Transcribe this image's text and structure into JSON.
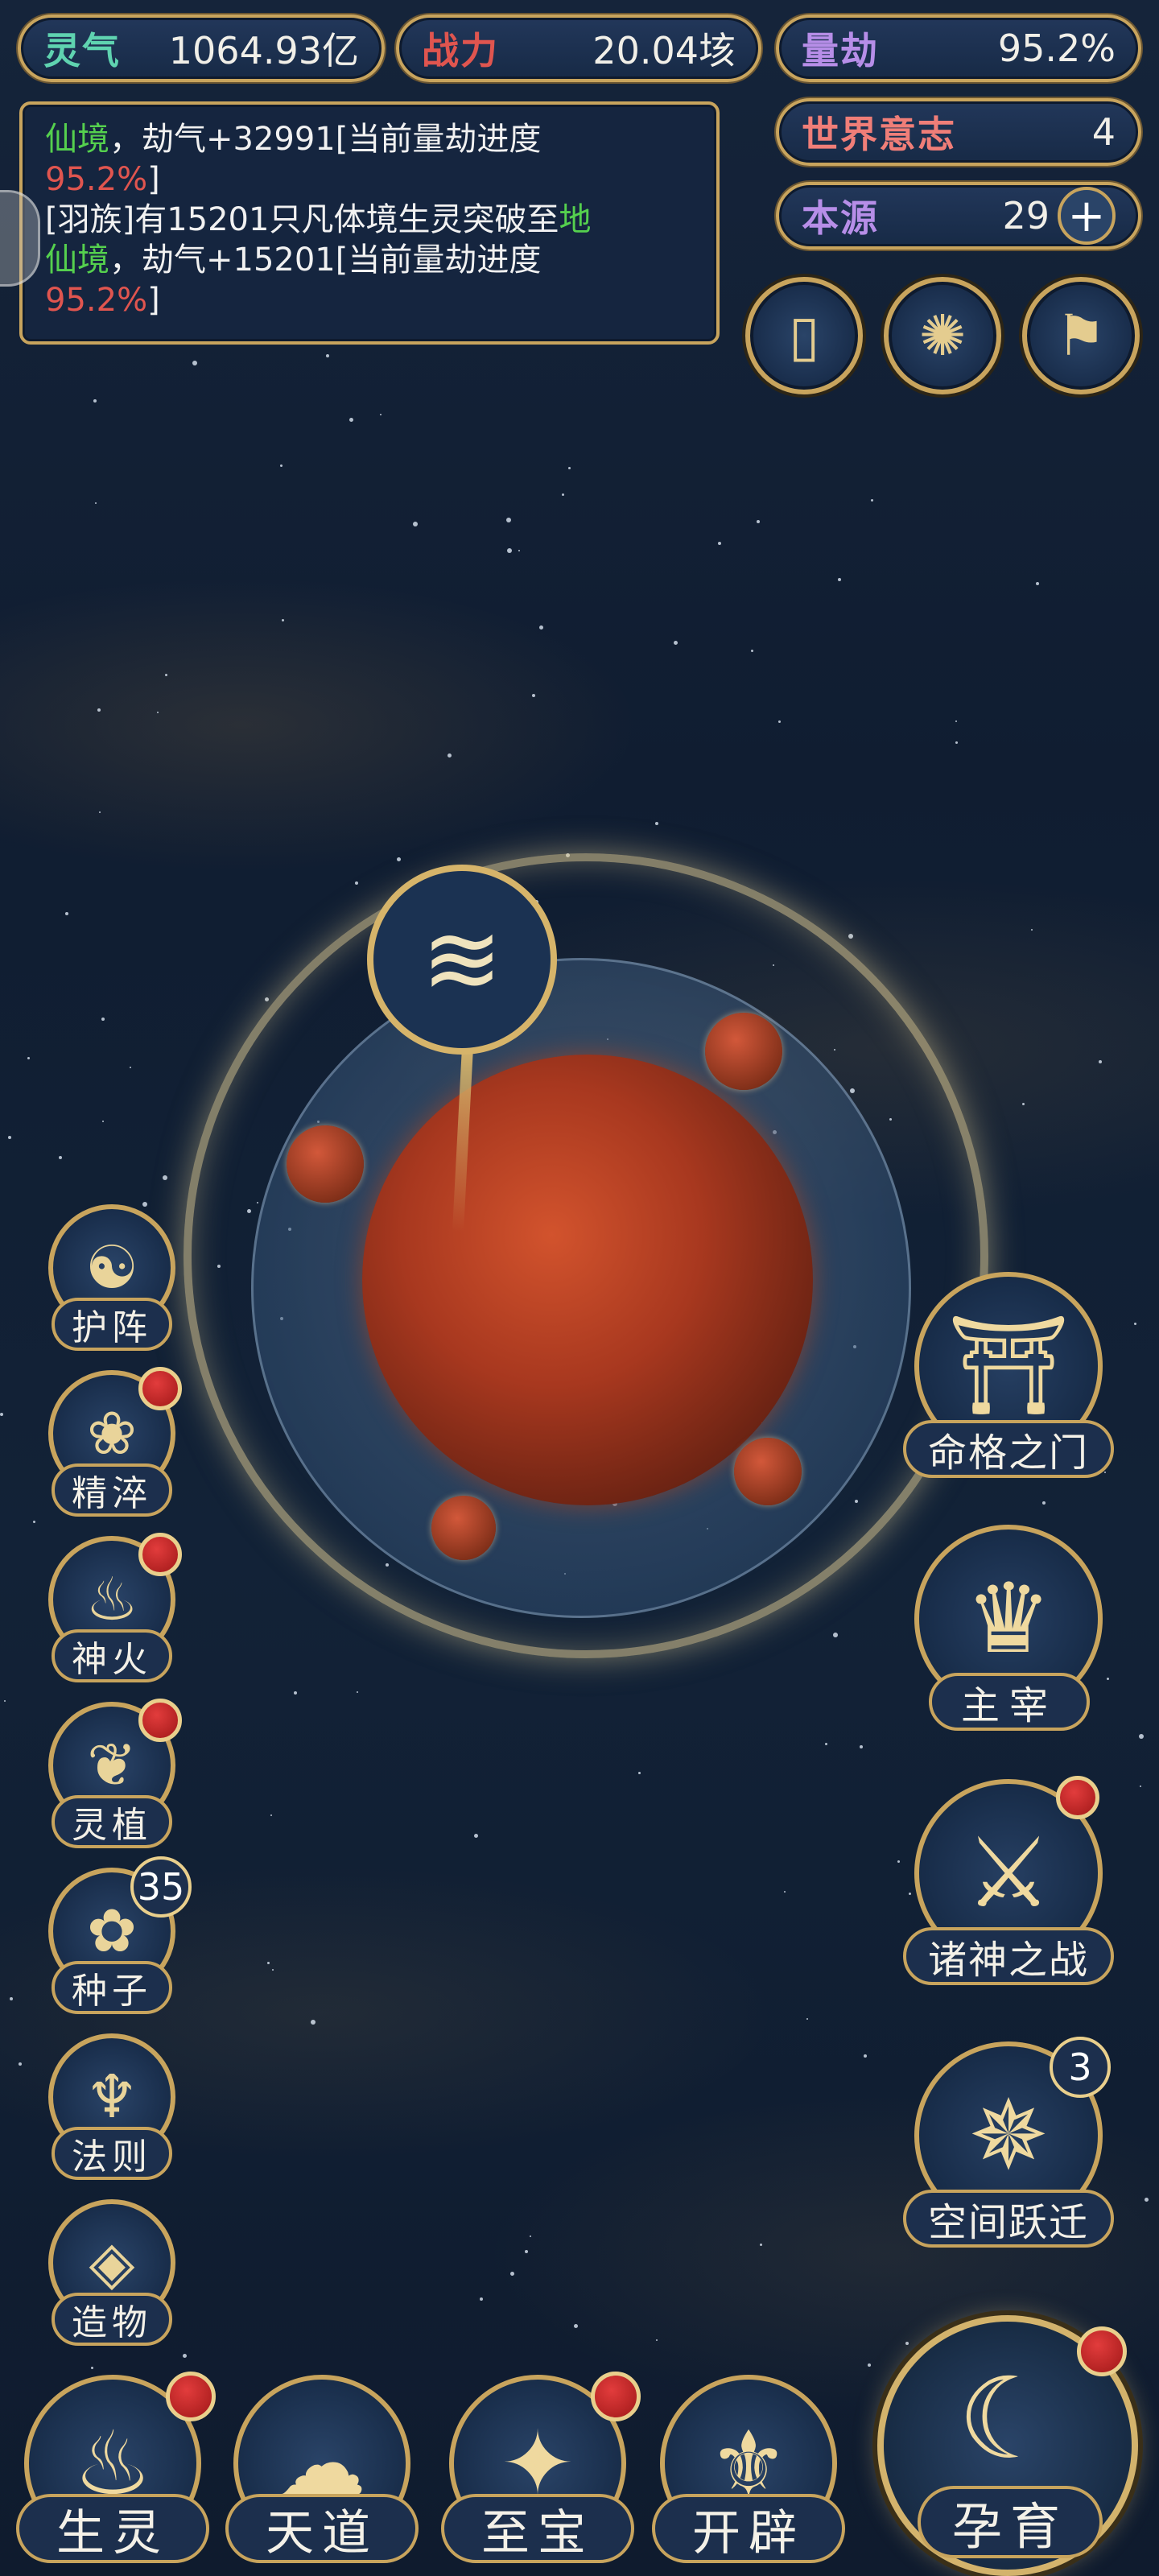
{
  "stats": {
    "lingqi": {
      "label": "灵气",
      "value": "1064.93亿",
      "label_color": "#5fd3b0"
    },
    "zhanli": {
      "label": "战力",
      "value": "20.04垓",
      "label_color": "#e0554f"
    },
    "lianjie": {
      "label": "量劫",
      "value": "95.2%",
      "label_color": "#b78ee8"
    },
    "shijie": {
      "label": "世界意志",
      "value": "4",
      "label_color": "#f07e78"
    },
    "benyuan": {
      "label": "本源",
      "value": "29",
      "label_color": "#b78ee8",
      "add_icon": "plus-icon"
    }
  },
  "log": {
    "lines": [
      {
        "green": "仙境",
        "text": "，劫气+32991[当前量劫进度",
        "red": "95.2%",
        "end": "]"
      },
      {
        "prefix": "[羽族]有15201只凡体境生灵突破至",
        "green_a": "地",
        "green": "仙境",
        "text": "，劫气+15201[当前量劫进度",
        "red": "95.2%",
        "end": "]"
      }
    ]
  },
  "top_buttons": [
    {
      "name": "scroll-icon",
      "glyph": "▯"
    },
    {
      "name": "vortex-icon",
      "glyph": "✺"
    },
    {
      "name": "flag-icon",
      "glyph": "⚑"
    }
  ],
  "left_menu": [
    {
      "label": "护阵",
      "icon": "yin-yang-icon",
      "glyph": "☯",
      "red_dot": false
    },
    {
      "label": "精淬",
      "icon": "flame-lotus-icon",
      "glyph": "❀",
      "red_dot": true
    },
    {
      "label": "神火",
      "icon": "fire-icon",
      "glyph": "♨",
      "red_dot": true
    },
    {
      "label": "灵植",
      "icon": "plant-icon",
      "glyph": "❦",
      "red_dot": true
    },
    {
      "label": "种子",
      "icon": "seed-flower-icon",
      "glyph": "✿",
      "badge": "35"
    },
    {
      "label": "法则",
      "icon": "law-spirit-icon",
      "glyph": "♆",
      "red_dot": false
    },
    {
      "label": "造物",
      "icon": "diamond-icon",
      "glyph": "◈",
      "red_dot": false
    }
  ],
  "right_menu": [
    {
      "label": "命格之门",
      "icon": "gate-icon",
      "glyph": "⛩",
      "red_dot": false
    },
    {
      "label": "主宰",
      "icon": "dragon-icon",
      "glyph": "♛",
      "red_dot": false
    },
    {
      "label": "诸神之战",
      "icon": "sword-icon",
      "glyph": "⚔",
      "red_dot": true
    },
    {
      "label": "空间跃迁",
      "icon": "swirl-icon",
      "glyph": "✵",
      "badge": "3"
    }
  ],
  "bottom_menu": [
    {
      "label": "生灵",
      "icon": "phoenix-icon",
      "glyph": "♨",
      "red_dot": true
    },
    {
      "label": "天道",
      "icon": "cloud-icon",
      "glyph": "☁",
      "red_dot": false
    },
    {
      "label": "至宝",
      "icon": "treasure-icon",
      "glyph": "✦",
      "red_dot": true
    },
    {
      "label": "开辟",
      "icon": "axe-icon",
      "glyph": "⚜",
      "red_dot": false
    }
  ],
  "breed": {
    "label": "孕育",
    "icon": "embryo-icon",
    "glyph": "☾",
    "red_dot": true
  },
  "planet": {
    "marker_icon": "wave-icon",
    "marker_glyph": "≋"
  }
}
